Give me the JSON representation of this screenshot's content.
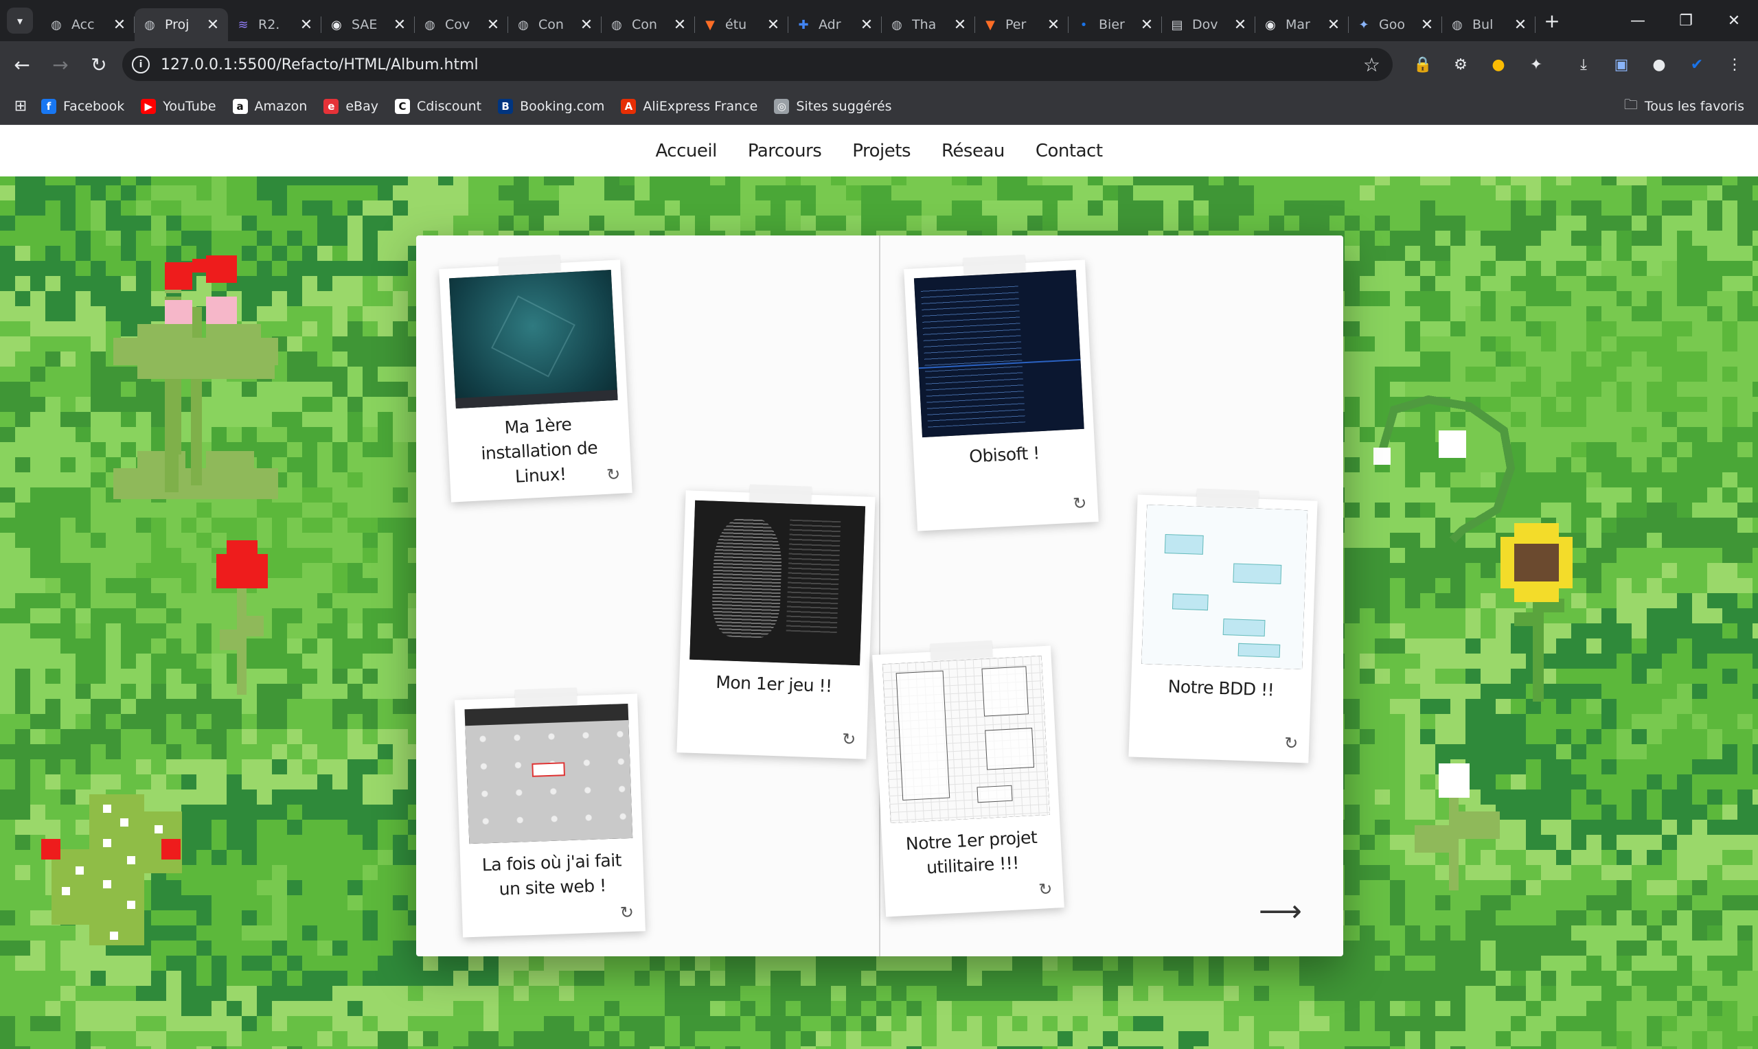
{
  "browser": {
    "tabs": [
      {
        "title": "Acc",
        "icon": "globe-icon"
      },
      {
        "title": "Proj",
        "icon": "globe-icon",
        "active": true
      },
      {
        "title": "R2.",
        "icon": "wave-icon"
      },
      {
        "title": "SAE",
        "icon": "github-icon"
      },
      {
        "title": "Cov",
        "icon": "globe-icon"
      },
      {
        "title": "Con",
        "icon": "globe-icon"
      },
      {
        "title": "Con",
        "icon": "globe-icon"
      },
      {
        "title": "étu",
        "icon": "gitlab-icon"
      },
      {
        "title": "Adr",
        "icon": "plus-icon"
      },
      {
        "title": "Tha",
        "icon": "globe-icon"
      },
      {
        "title": "Per",
        "icon": "gitlab-icon"
      },
      {
        "title": "Bier",
        "icon": "dot-icon"
      },
      {
        "title": "Dov",
        "icon": "doc-icon"
      },
      {
        "title": "Mar",
        "icon": "github-icon"
      },
      {
        "title": "Goo",
        "icon": "gemini-icon"
      },
      {
        "title": "Bul",
        "icon": "globe-icon"
      }
    ],
    "url": "127.0.0.1:5500/Refacto/HTML/Album.html",
    "bookmarks": [
      {
        "label": "Facebook",
        "glyph": "f",
        "color": "#1877f2"
      },
      {
        "label": "YouTube",
        "glyph": "▶",
        "color": "#ff0000"
      },
      {
        "label": "Amazon",
        "glyph": "a",
        "color": "#ffffff"
      },
      {
        "label": "eBay",
        "glyph": "e",
        "color": "#e53238"
      },
      {
        "label": "Cdiscount",
        "glyph": "C",
        "color": "#ffffff"
      },
      {
        "label": "Booking.com",
        "glyph": "B",
        "color": "#003580"
      },
      {
        "label": "AliExpress France",
        "glyph": "A",
        "color": "#e62e04"
      },
      {
        "label": "Sites suggérés",
        "glyph": "◎",
        "color": "#9aa0a6"
      }
    ],
    "all_bookmarks": "Tous les favoris"
  },
  "site_nav": [
    "Accueil",
    "Parcours",
    "Projets",
    "Réseau",
    "Contact"
  ],
  "album": {
    "next_arrow": "⟶",
    "flip_glyph": "↻",
    "photos": [
      {
        "caption": "Ma 1ère installation de Linux!",
        "scene": "linux-desktop"
      },
      {
        "caption": "Mon 1er jeu !!",
        "scene": "ascii-game"
      },
      {
        "caption": "La fois où j'ai fait un site web !",
        "scene": "website"
      },
      {
        "caption": "Obisoft !",
        "scene": "code-editor"
      },
      {
        "caption": "Notre BDD !!",
        "scene": "db-diagram"
      },
      {
        "caption": "Notre 1er projet utilitaire !!!",
        "scene": "uml-diagram"
      }
    ]
  }
}
